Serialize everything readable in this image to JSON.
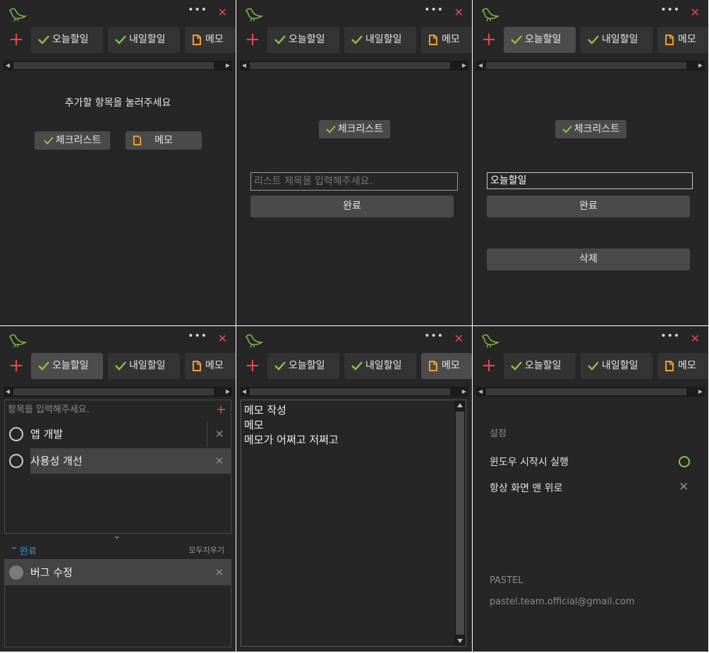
{
  "common": {
    "more_label": "•••",
    "close_label": "✕",
    "add_label": "+",
    "tab_today": "오늘할일",
    "tab_tomorrow": "내일할일",
    "tab_memo": "메모",
    "scroll_left": "◀",
    "scroll_right": "▶"
  },
  "panel1": {
    "prompt": "추가할 항목을 눌러주세요",
    "checklist_label": "체크리스트",
    "memo_label": "메모"
  },
  "panel2": {
    "checklist_label": "체크리스트",
    "title_placeholder": "리스트 제목을 입력해주세요.",
    "done_label": "완료"
  },
  "panel3": {
    "checklist_label": "체크리스트",
    "title_value": "오늘할일",
    "done_label": "완료",
    "delete_label": "삭제"
  },
  "panel4": {
    "item_placeholder": "항목을 입력해주세요.",
    "items": [
      {
        "text": "앱 개발",
        "checked": false
      },
      {
        "text": "사용성 개선",
        "checked": false
      }
    ],
    "collapse_icon": "⌄",
    "done_section_label": "완료",
    "clear_all_label": "모두지우기",
    "done_items": [
      {
        "text": "버그 수정",
        "checked": true
      }
    ]
  },
  "panel5": {
    "memo_lines": [
      "메모 작성",
      "메모",
      "메모가 어쩌고 저쩌고"
    ]
  },
  "panel6": {
    "settings_label": "설정",
    "option_startup": "윈도우 시작시 실행",
    "option_startup_on": true,
    "option_topmost": "항상 화면 맨 위로",
    "option_topmost_on": false,
    "brand": "PASTEL",
    "email": "pastel.team.official@gmail.com"
  },
  "colors": {
    "background": "#262626",
    "accent_red": "#e24a4a",
    "check_green": "#8ac34a",
    "memo_orange": "#f0a030",
    "done_blue": "#3d8fd6"
  }
}
